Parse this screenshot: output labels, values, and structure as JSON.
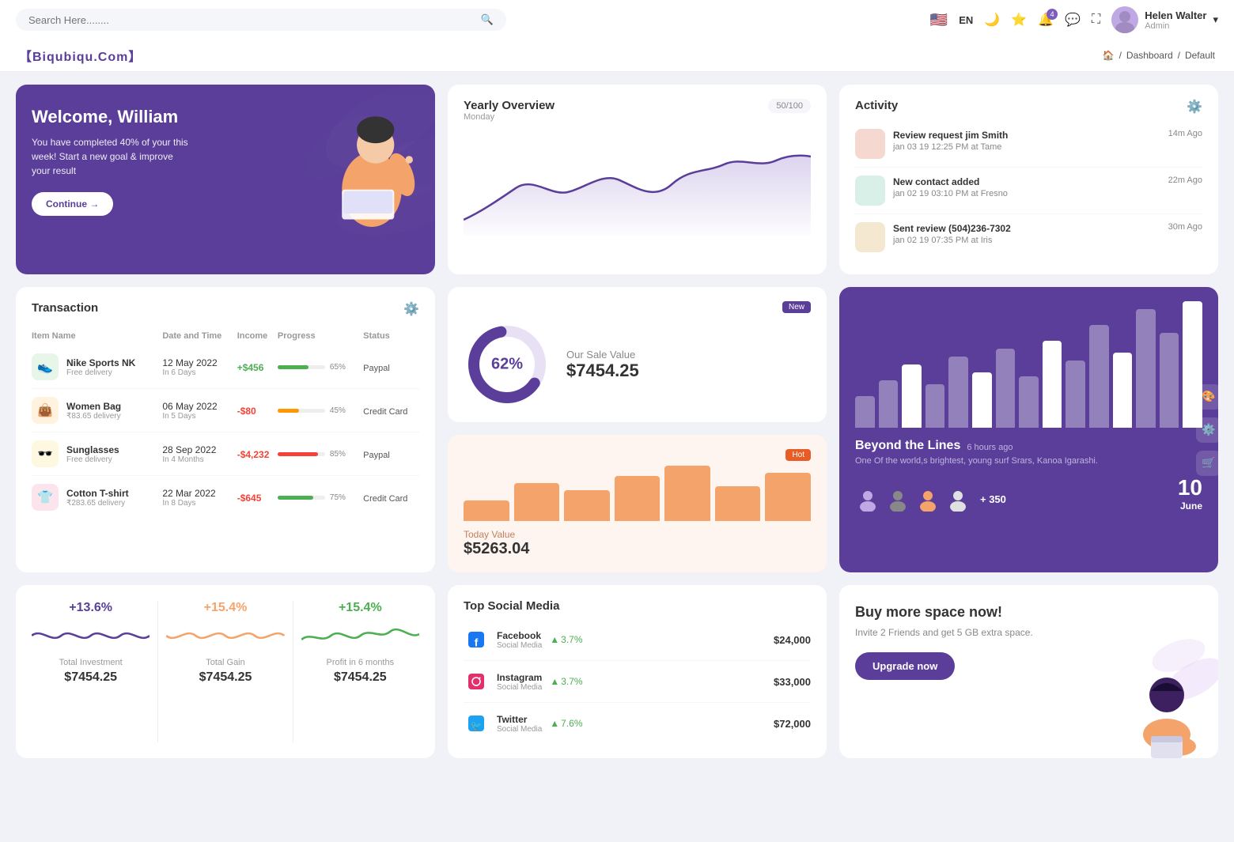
{
  "topnav": {
    "search_placeholder": "Search Here........",
    "lang": "EN",
    "notification_count": "4",
    "user_name": "Helen Walter",
    "user_role": "Admin"
  },
  "subnav": {
    "brand": "【Biqubiqu.Com】",
    "breadcrumb": [
      "🏠",
      "/",
      "Dashboard",
      "/",
      "Default"
    ]
  },
  "welcome": {
    "title": "Welcome, William",
    "desc": "You have completed 40% of your this week! Start a new goal & improve your result",
    "btn": "Continue →"
  },
  "yearly": {
    "title": "Yearly Overview",
    "subtitle": "Monday",
    "badge": "50/100"
  },
  "activity": {
    "title": "Activity",
    "items": [
      {
        "title": "Review request jim Smith",
        "time_detail": "jan 03 19 12:25 PM at Tame",
        "time_ago": "14m Ago"
      },
      {
        "title": "New contact added",
        "time_detail": "jan 02 19 03:10 PM at Fresno",
        "time_ago": "22m Ago"
      },
      {
        "title": "Sent review (504)236-7302",
        "time_detail": "jan 02 19 07:35 PM at Iris",
        "time_ago": "30m Ago"
      }
    ]
  },
  "transaction": {
    "title": "Transaction",
    "headers": [
      "Item Name",
      "Date and Time",
      "Income",
      "Progress",
      "Status"
    ],
    "rows": [
      {
        "name": "Nike Sports NK",
        "sub": "Free delivery",
        "icon": "👟",
        "icon_bg": "#e8f5e9",
        "date": "12 May 2022",
        "date_sub": "In 6 Days",
        "income": "+$456",
        "income_type": "pos",
        "progress": 65,
        "progress_color": "#4caf50",
        "status": "Paypal"
      },
      {
        "name": "Women Bag",
        "sub": "₹83.65 delivery",
        "icon": "👜",
        "icon_bg": "#fff3e0",
        "date": "06 May 2022",
        "date_sub": "In 5 Days",
        "income": "-$80",
        "income_type": "neg",
        "progress": 45,
        "progress_color": "#ff9800",
        "status": "Credit Card"
      },
      {
        "name": "Sunglasses",
        "sub": "Free delivery",
        "icon": "🕶️",
        "icon_bg": "#fff8e1",
        "date": "28 Sep 2022",
        "date_sub": "In 4 Months",
        "income": "-$4,232",
        "income_type": "neg",
        "progress": 85,
        "progress_color": "#f44336",
        "status": "Paypal"
      },
      {
        "name": "Cotton T-shirt",
        "sub": "₹283.65 delivery",
        "icon": "👕",
        "icon_bg": "#fce4ec",
        "date": "22 Mar 2022",
        "date_sub": "In 8 Days",
        "income": "-$645",
        "income_type": "neg",
        "progress": 75,
        "progress_color": "#4caf50",
        "status": "Credit Card"
      }
    ]
  },
  "sale_value": {
    "badge": "New",
    "percent": "62%",
    "label": "Our Sale Value",
    "value": "$7454.25"
  },
  "today_value": {
    "badge": "Hot",
    "label": "Today Value",
    "value": "$5263.04",
    "bars": [
      30,
      55,
      45,
      65,
      80,
      50,
      70
    ]
  },
  "beyond": {
    "title": "Beyond the Lines",
    "time_ago": "6 hours ago",
    "desc": "One Of the world,s brightest, young surf Srars, Kanoa Igarashi.",
    "plus_count": "+ 350",
    "date_num": "10",
    "date_month": "June",
    "bars": [
      40,
      60,
      80,
      55,
      90,
      70,
      100,
      65,
      110,
      85,
      130,
      95,
      150,
      120,
      160
    ]
  },
  "stats": [
    {
      "pct": "+13.6%",
      "label": "Total Investment",
      "value": "$7454.25",
      "color": "#5a3e99"
    },
    {
      "pct": "+15.4%",
      "label": "Total Gain",
      "value": "$7454.25",
      "color": "#f4a46a"
    },
    {
      "pct": "+15.4%",
      "label": "Profit in 6 months",
      "value": "$7454.25",
      "color": "#4caf50"
    }
  ],
  "social": {
    "title": "Top Social Media",
    "items": [
      {
        "name": "Facebook",
        "sub": "Social Media",
        "pct": "3.7%",
        "value": "$24,000",
        "color": "#1877f2",
        "icon": "f"
      },
      {
        "name": "Instagram",
        "sub": "Social Media",
        "pct": "3.7%",
        "value": "$33,000",
        "color": "#e1306c",
        "icon": "📷"
      },
      {
        "name": "Twitter",
        "sub": "Social Media",
        "pct": "7.6%",
        "value": "$72,000",
        "color": "#1da1f2",
        "icon": "🐦"
      }
    ]
  },
  "upgrade": {
    "title": "Buy more space now!",
    "desc": "Invite 2 Friends and get 5 GB extra space.",
    "btn": "Upgrade now"
  }
}
